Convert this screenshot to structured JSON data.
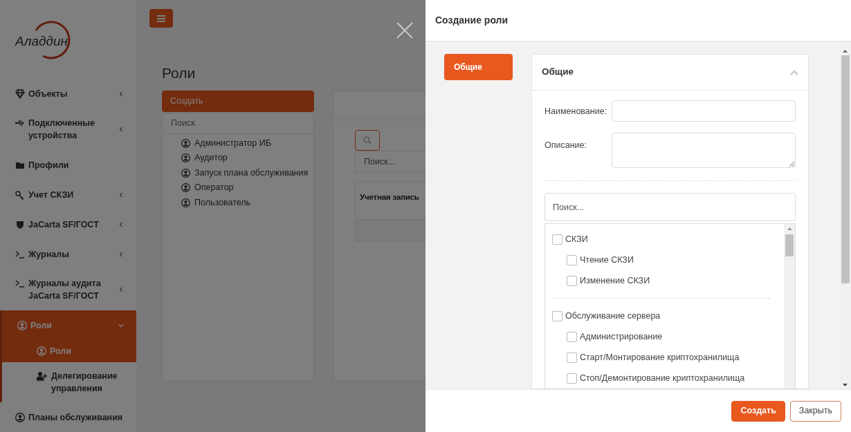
{
  "sidebar": {
    "logo": "Аладдин",
    "items": [
      {
        "label": "Объекты",
        "expanded": false,
        "selected": false
      },
      {
        "label": "Подключенные устройства",
        "expanded": false,
        "selected": false
      },
      {
        "label": "Профили",
        "selected": false
      },
      {
        "label": "Учет СКЗИ",
        "expanded": false,
        "selected": false
      },
      {
        "label": "JaCarta SF/ГОСТ",
        "expanded": false,
        "selected": false
      },
      {
        "label": "Журналы",
        "expanded": false,
        "selected": false
      },
      {
        "label": "Журналы аудита JaCarta SF/ГОСТ",
        "expanded": false,
        "selected": false
      },
      {
        "label": "Роли",
        "expanded": true,
        "selected": true,
        "children": [
          {
            "label": "Роли",
            "selected": true
          },
          {
            "label": "Делегирование управления",
            "selected": false
          }
        ]
      },
      {
        "label": "Планы обслуживания",
        "selected": false
      }
    ]
  },
  "page": {
    "title": "Роли",
    "roles_panel": {
      "create_button": "Создать",
      "search_placeholder": "Поиск",
      "roles": [
        "Администратор ИБ",
        "Аудитор",
        "Запуск плана обслуживания",
        "Оператор",
        "Пользователь"
      ]
    },
    "accounts_panel": {
      "search_placeholder": "Поиск...",
      "columns": [
        "Учетная запись"
      ]
    }
  },
  "modal": {
    "title": "Создание роли",
    "tabs": [
      {
        "label": "Общие",
        "selected": true
      }
    ],
    "section": {
      "title": "Общие",
      "expanded": true,
      "fields": [
        {
          "label": "Наименование:",
          "kind": "input"
        },
        {
          "label": "Описание:",
          "kind": "textarea"
        }
      ],
      "permission_search_placeholder": "Поиск...",
      "permission_groups": [
        {
          "label": "СКЗИ",
          "checked": false,
          "children": [
            {
              "label": "Чтение СКЗИ",
              "checked": false
            },
            {
              "label": "Изменение СКЗИ",
              "checked": false
            }
          ]
        },
        {
          "label": "Обслуживание сервера",
          "checked": false,
          "children": [
            {
              "label": "Администрирование",
              "checked": false
            },
            {
              "label": "Старт/Монтирование криптохранилища",
              "checked": false
            },
            {
              "label": "Стоп/Демонтирование криптохранилища",
              "checked": false
            }
          ]
        }
      ]
    },
    "buttons": [
      {
        "label": "Создать",
        "kind": "primary"
      },
      {
        "label": "Закрыть",
        "kind": "secondary"
      }
    ]
  }
}
